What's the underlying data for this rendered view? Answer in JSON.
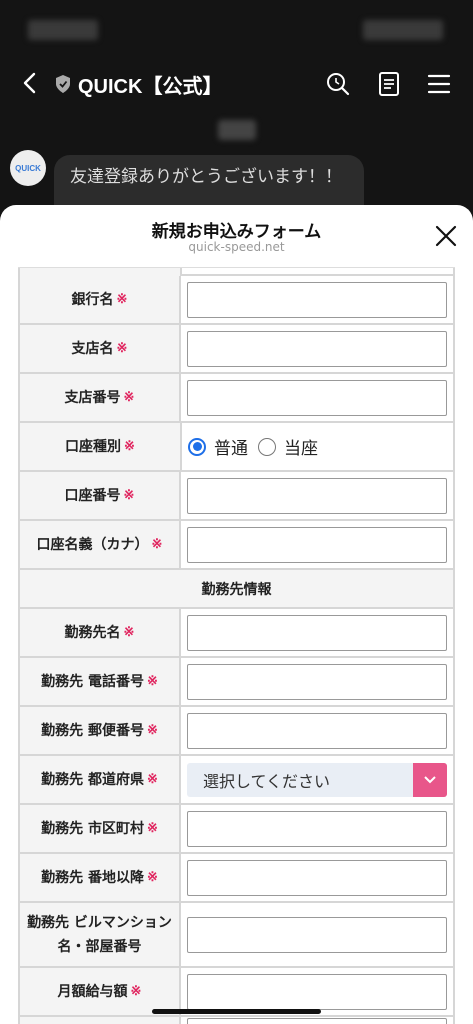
{
  "chat": {
    "title": "QUICK【公式】",
    "avatar_text": "QUICK",
    "message": "友達登録ありがとうございます！！"
  },
  "sheet": {
    "title": "新規お申込みフォーム",
    "subtitle": "quick-speed.net"
  },
  "form": {
    "required_mark": "※",
    "bank_name": "銀行名",
    "branch_name": "支店名",
    "branch_number": "支店番号",
    "account_type": "口座種別",
    "account_type_options": [
      "普通",
      "当座"
    ],
    "account_type_selected": "普通",
    "account_number": "口座番号",
    "account_holder": "口座名義（カナ）",
    "section_employer": "勤務先情報",
    "employer_name": "勤務先名",
    "employer_phone": "勤務先 電話番号",
    "employer_postal": "勤務先 郵便番号",
    "employer_pref": "勤務先 都道府県",
    "pref_placeholder": "選択してください",
    "employer_city": "勤務先 市区町村",
    "employer_address": "勤務先 番地以降",
    "employer_building": "勤務先 ビルマンション名・部屋番号",
    "monthly_salary": "月額給与額"
  },
  "colors": {
    "accent_blue": "#1e6fe8",
    "select_button": "#e8568a",
    "required": "#e0245e"
  }
}
